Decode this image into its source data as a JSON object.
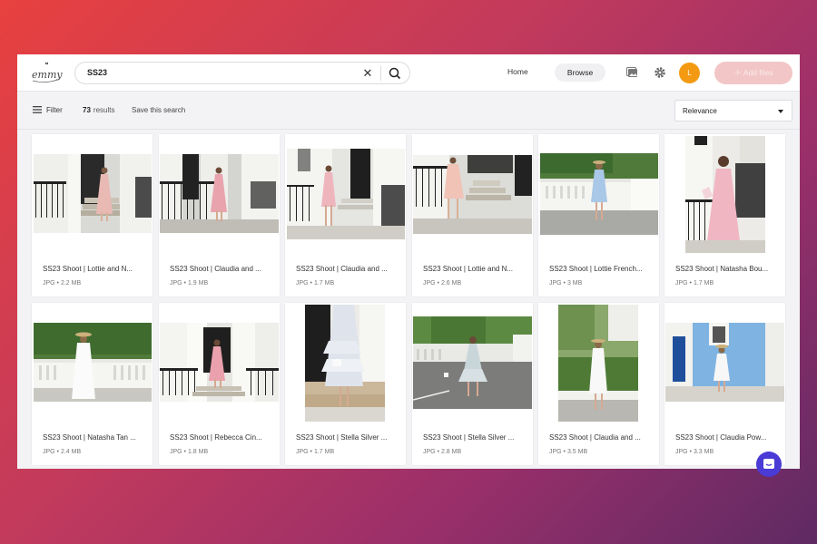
{
  "app": {
    "logo_text": "emmy",
    "search": {
      "value": "SS23"
    },
    "nav": {
      "home": "Home",
      "browse": "Browse"
    },
    "user_initial": "L",
    "add_files_label": "Add files",
    "icons": [
      "logo-icon",
      "close-icon",
      "search-icon",
      "gallery-icon",
      "gear-icon",
      "plus-icon",
      "filter-icon",
      "chat-icon"
    ],
    "colors": {
      "accent": "#f39a12",
      "add_files_bg": "#f2c6c6",
      "chat": "#4a3bd6"
    }
  },
  "toolbar": {
    "filter_label": "Filter",
    "results_count": "73",
    "results_label": "results",
    "save_search_label": "Save this search",
    "sort_value": "Relevance"
  },
  "assets": [
    {
      "title": "SS23 Shoot | Lottie and N...",
      "meta": "JPG  •  2.2 MB"
    },
    {
      "title": "SS23 Shoot | Claudia and ...",
      "meta": "JPG  •  1.9 MB"
    },
    {
      "title": "SS23 Shoot | Claudia and ...",
      "meta": "JPG  •  1.7 MB"
    },
    {
      "title": "SS23 Shoot | Lottie and N...",
      "meta": "JPG  •  2.6 MB"
    },
    {
      "title": "SS23 Shoot | Lottie French...",
      "meta": "JPG  •  3 MB"
    },
    {
      "title": "SS23 Shoot | Natasha Bou...",
      "meta": "JPG  •  1.7 MB"
    },
    {
      "title": "SS23 Shoot | Natasha Tan ...",
      "meta": "JPG  •  2.4 MB"
    },
    {
      "title": "SS23 Shoot | Rebecca Cin...",
      "meta": "JPG  •  1.8 MB"
    },
    {
      "title": "SS23 Shoot | Stella Silver ...",
      "meta": "JPG  •  1.7 MB"
    },
    {
      "title": "SS23 Shoot | Stella Silver ...",
      "meta": "JPG  •  2.8 MB"
    },
    {
      "title": "SS23 Shoot | Claudia and ...",
      "meta": "JPG  •  3.5 MB"
    },
    {
      "title": "SS23 Shoot | Claudia Pow...",
      "meta": "JPG  •  3.3 MB"
    }
  ]
}
